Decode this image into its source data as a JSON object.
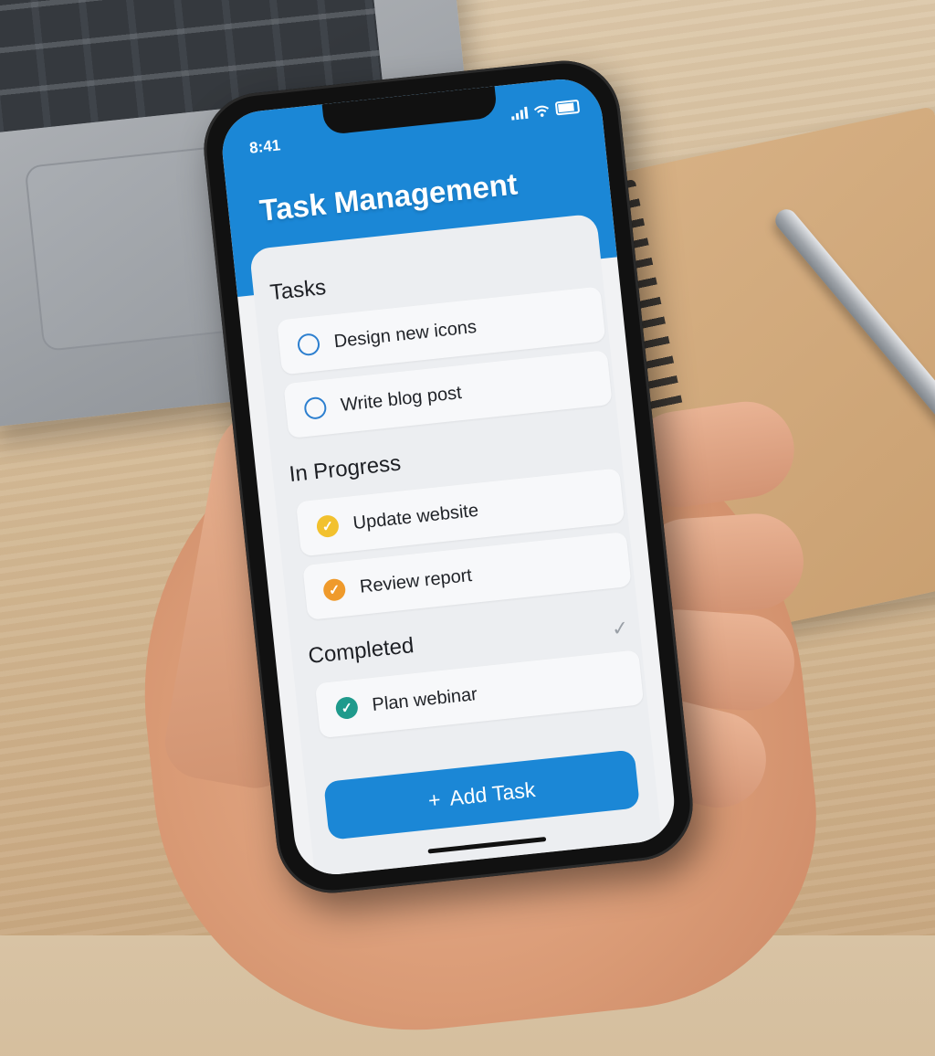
{
  "status_bar": {
    "time": "8:41"
  },
  "app": {
    "title": "Task Management",
    "accent_color": "#1b87d6"
  },
  "sections": [
    {
      "title": "Tasks",
      "tasks": [
        {
          "label": "Design new icons",
          "status": "open",
          "icon": "circle-outline-icon",
          "color": "#2c7fcf"
        },
        {
          "label": "Write blog post",
          "status": "open",
          "icon": "circle-outline-icon",
          "color": "#2c7fcf"
        }
      ]
    },
    {
      "title": "In Progress",
      "tasks": [
        {
          "label": "Update website",
          "status": "in-progress",
          "icon": "check-circle-icon",
          "color": "#f2c12e"
        },
        {
          "label": "Review report",
          "status": "in-progress",
          "icon": "check-circle-icon",
          "color": "#ef9a2b"
        }
      ]
    },
    {
      "title": "Completed",
      "tasks": [
        {
          "label": "Plan webinar",
          "status": "completed",
          "icon": "check-circle-icon",
          "color": "#1f9a8c"
        }
      ]
    }
  ],
  "add_button": {
    "icon": "+",
    "label": "Add Task"
  }
}
